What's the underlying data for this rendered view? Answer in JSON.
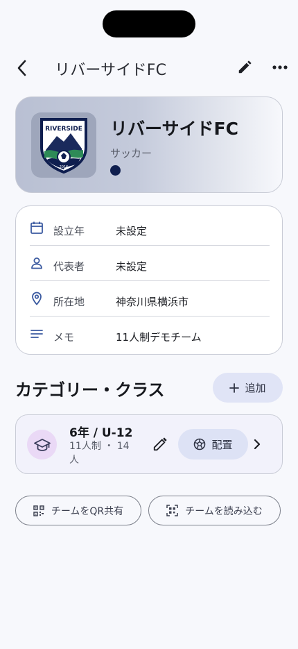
{
  "header": {
    "title": "リバーサイドFC",
    "back_icon": "chevron-left-icon",
    "edit_icon": "pencil-icon",
    "more_icon": "more-horizontal-icon"
  },
  "team": {
    "name": "リバーサイドFC",
    "sport": "サッカー",
    "logo_text": "RIVERSIDE",
    "logo_year": "2016",
    "team_color": "#0f1e4f"
  },
  "info": {
    "rows": [
      {
        "icon": "calendar-icon",
        "label": "設立年",
        "value": "未設定"
      },
      {
        "icon": "person-icon",
        "label": "代表者",
        "value": "未設定"
      },
      {
        "icon": "location-pin-icon",
        "label": "所在地",
        "value": "神奈川県横浜市"
      },
      {
        "icon": "notes-icon",
        "label": "メモ",
        "value": "11人制デモチーム"
      }
    ]
  },
  "categories": {
    "title": "カテゴリー・クラス",
    "add_label": "追加",
    "items": [
      {
        "name": "6年 / U-12",
        "meta": "11人制 ・ 14人",
        "assign_label": "配置"
      }
    ]
  },
  "actions": {
    "share_qr_label": "チームをQR共有",
    "scan_label": "チームを読み込む"
  },
  "colors": {
    "accent": "#dde2f5",
    "background": "#f7f8fc",
    "category_icon_bg": "#ead9f6"
  }
}
